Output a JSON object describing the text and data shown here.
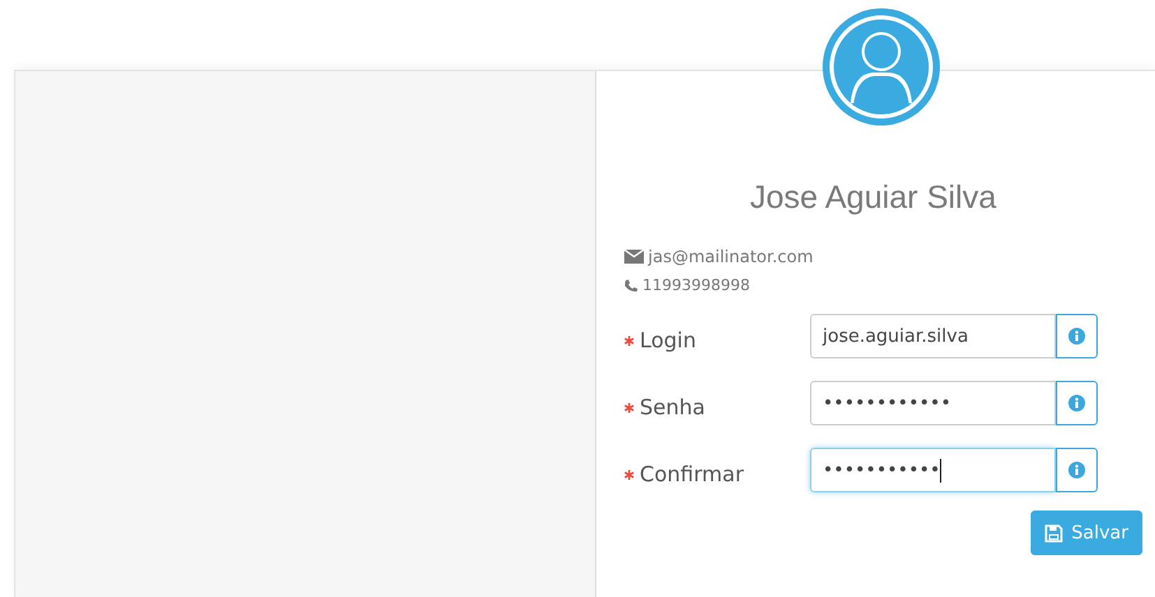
{
  "profile": {
    "name": "Jose Aguiar Silva",
    "email": "jas@mailinator.com",
    "phone": "11993998998"
  },
  "fields": [
    {
      "label": "Login",
      "required": true,
      "value": "jose.aguiar.silva",
      "focused": false
    },
    {
      "label": "Senha",
      "required": true,
      "value": "••••••••••••",
      "focused": false
    },
    {
      "label": "Confirmar",
      "required": true,
      "value": "•••••••••••",
      "focused": true
    }
  ],
  "save_button": {
    "label": "Salvar"
  }
}
